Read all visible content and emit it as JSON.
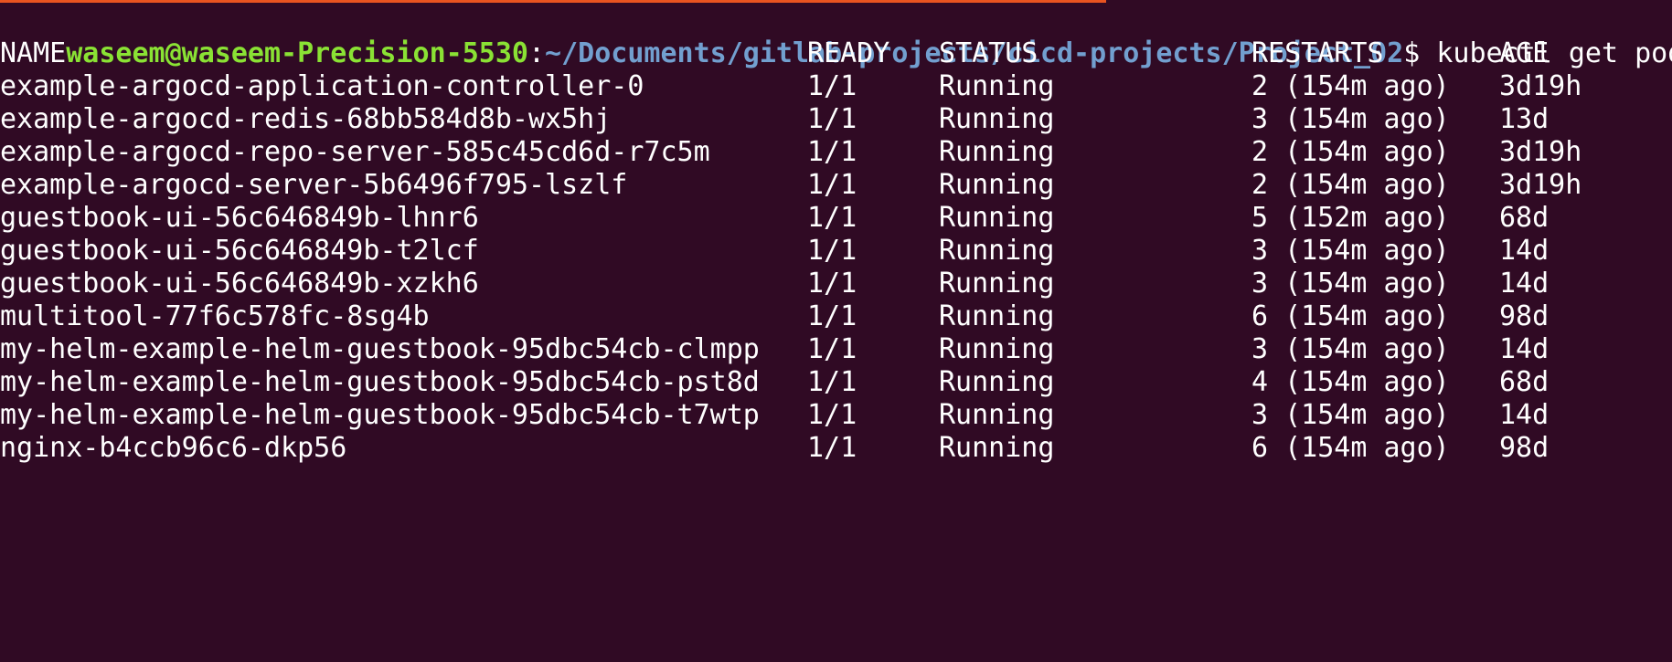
{
  "window": {
    "accent_color": "#e95420",
    "background_color": "#300a24"
  },
  "prompt": {
    "user_host": "waseem@waseem-Precision-5530",
    "separator": ":",
    "path": "~/Documents/gitlab-projects/cicd-projects/Project_02",
    "dollar": "$ ",
    "command": "kubectl get pods",
    "colors": {
      "user_host": "#8ae234",
      "path": "#729fcf"
    }
  },
  "table": {
    "headers": [
      "NAME",
      "READY",
      "STATUS",
      "RESTARTS",
      "AGE"
    ],
    "rows": [
      [
        "example-argocd-application-controller-0",
        "1/1",
        "Running",
        "2 (154m ago)",
        "3d19h"
      ],
      [
        "example-argocd-redis-68bb584d8b-wx5hj",
        "1/1",
        "Running",
        "3 (154m ago)",
        "13d"
      ],
      [
        "example-argocd-repo-server-585c45cd6d-r7c5m",
        "1/1",
        "Running",
        "2 (154m ago)",
        "3d19h"
      ],
      [
        "example-argocd-server-5b6496f795-lszlf",
        "1/1",
        "Running",
        "2 (154m ago)",
        "3d19h"
      ],
      [
        "guestbook-ui-56c646849b-lhnr6",
        "1/1",
        "Running",
        "5 (152m ago)",
        "68d"
      ],
      [
        "guestbook-ui-56c646849b-t2lcf",
        "1/1",
        "Running",
        "3 (154m ago)",
        "14d"
      ],
      [
        "guestbook-ui-56c646849b-xzkh6",
        "1/1",
        "Running",
        "3 (154m ago)",
        "14d"
      ],
      [
        "multitool-77f6c578fc-8sg4b",
        "1/1",
        "Running",
        "6 (154m ago)",
        "98d"
      ],
      [
        "my-helm-example-helm-guestbook-95dbc54cb-clmpp",
        "1/1",
        "Running",
        "3 (154m ago)",
        "14d"
      ],
      [
        "my-helm-example-helm-guestbook-95dbc54cb-pst8d",
        "1/1",
        "Running",
        "4 (154m ago)",
        "68d"
      ],
      [
        "my-helm-example-helm-guestbook-95dbc54cb-t7wtp",
        "1/1",
        "Running",
        "3 (154m ago)",
        "14d"
      ],
      [
        "nginx-b4ccb96c6-dkp56",
        "1/1",
        "Running",
        "6 (154m ago)",
        "98d"
      ]
    ]
  }
}
